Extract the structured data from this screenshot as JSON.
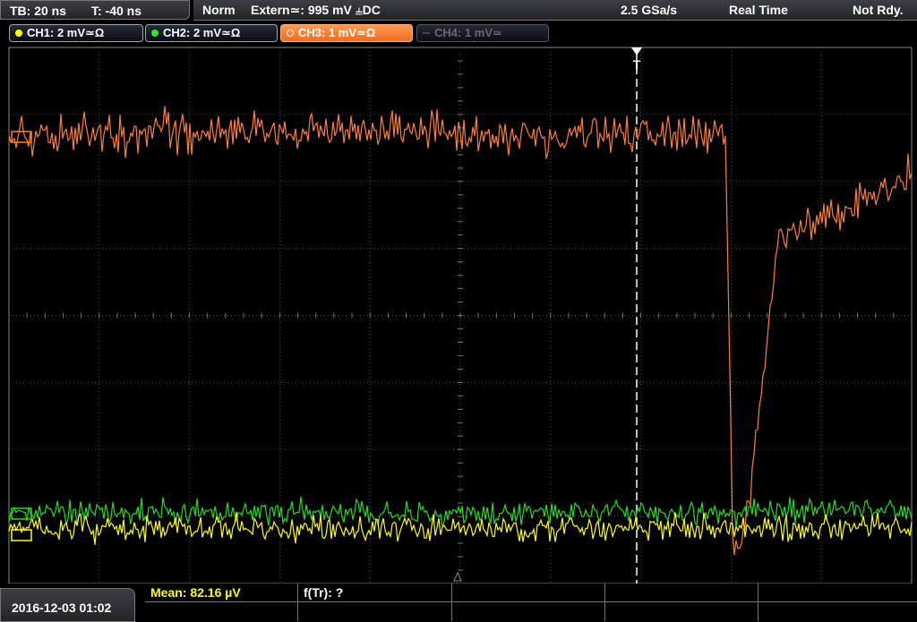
{
  "timebase": {
    "tb": "TB: 20 ns",
    "t": "T: -40 ns"
  },
  "status": {
    "mode": "Norm",
    "trigger": "Extern≃: 995 mV ⫨DC",
    "sample_rate": "2.5 GSa/s",
    "acquisition": "Real Time",
    "state": "Not Rdy."
  },
  "channels": [
    {
      "label": "CH1: 2 mV≃Ω",
      "color": "#ffff00",
      "active": false,
      "enabled": true
    },
    {
      "label": "CH2: 2 mV≃Ω",
      "color": "#2ee62e",
      "active": false,
      "enabled": true
    },
    {
      "label": "CH3: 1 mV≃Ω",
      "color": "#ff8c3a",
      "active": true,
      "enabled": true
    },
    {
      "label": "CH4: 1 mV≃",
      "color": "#555555",
      "active": false,
      "enabled": false
    }
  ],
  "trigger_marker": "T",
  "waveform_colors": {
    "ch1": "#ffff00",
    "ch2": "#22dd22",
    "ch3": "#ff8030"
  },
  "datetime": "2016-12-03 01:02",
  "measurements": {
    "mean": "Mean: 82.16 µV",
    "ftr": "f(Tr): ?"
  }
}
